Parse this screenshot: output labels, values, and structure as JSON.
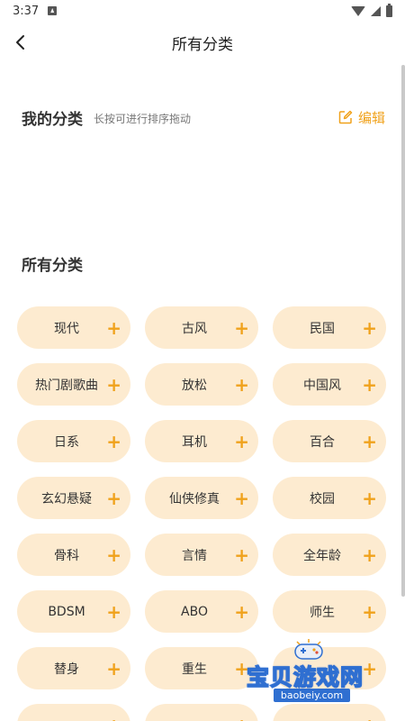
{
  "status_bar": {
    "time": "3:37"
  },
  "header": {
    "title": "所有分类"
  },
  "my_categories": {
    "title": "我的分类",
    "hint": "长按可进行排序拖动",
    "edit_label": "编辑"
  },
  "all_categories": {
    "title": "所有分类",
    "items": [
      "现代",
      "古风",
      "民国",
      "热门剧歌曲",
      "放松",
      "中国风",
      "日系",
      "耳机",
      "百合",
      "玄幻悬疑",
      "仙侠修真",
      "校园",
      "骨科",
      "言情",
      "全年龄",
      "BDSM",
      "ABO",
      "师生",
      "替身",
      "重生",
      "",
      "",
      "",
      ""
    ],
    "plus_symbol": "+"
  },
  "watermark": {
    "text": "宝贝游戏网",
    "url": "baobeiy.com"
  },
  "colors": {
    "accent": "#f0a21c",
    "chip_bg": "#fdebd0"
  }
}
